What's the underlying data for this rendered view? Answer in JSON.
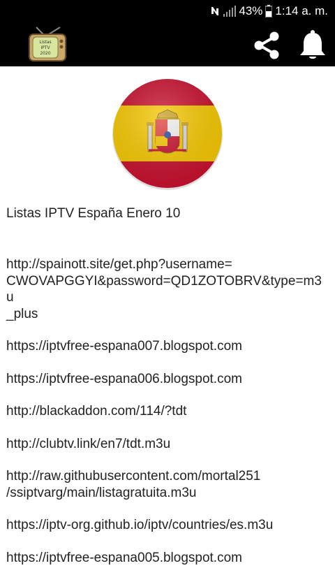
{
  "status_bar": {
    "battery": "43%",
    "time": "1:14 a. m."
  },
  "app_bar": {
    "logo_text": [
      "Listas",
      "IPTV",
      "2020"
    ],
    "icons": [
      "tv-logo-icon",
      "share-icon",
      "bell-icon"
    ]
  },
  "content": {
    "flag_icon": "spain-flag-icon",
    "heading": "Listas IPTV España Enero 10",
    "links": [
      {
        "line1": "http://spainott.site/get.php?username=",
        "line2": "CWOVAPGGYI&password=QD1ZOTOBRV&type=m3u",
        "line3": "_plus"
      },
      {
        "line1": "https://iptvfree-espana007.blogspot.com"
      },
      {
        "line1": "https://iptvfree-espana006.blogspot.com"
      },
      {
        "line1": "http://blackaddon.com/114/?tdt"
      },
      {
        "line1": "http://clubtv.link/en7/tdt.m3u"
      },
      {
        "line1": "http://raw.githubusercontent.com/mortal251",
        "line2": "/ssiptvarg/main/listagratuita.m3u"
      },
      {
        "line1": "https://iptv-org.github.io/iptv/countries/es.m3u"
      },
      {
        "line1": "https://iptvfree-espana005.blogspot.com"
      }
    ]
  },
  "colors": {
    "bar_background": "#000000",
    "page_background": "#ffffff",
    "text": "#222222",
    "flag_red": "#c8102e",
    "flag_yellow": "#f6c800"
  }
}
